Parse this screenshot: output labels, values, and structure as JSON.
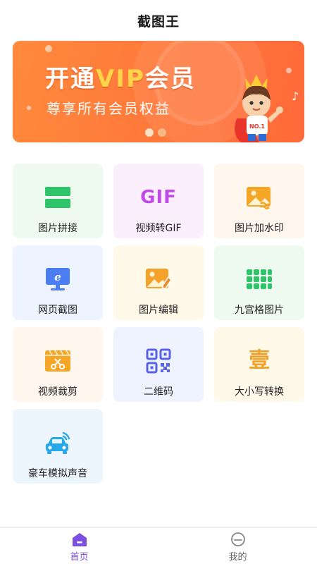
{
  "header": {
    "title": "截图王"
  },
  "banner": {
    "headline_pre": "开通",
    "headline_vip": "VIP",
    "headline_post": "会员",
    "subtitle": "尊享所有会员权益",
    "mascot_shirt": "NO.1"
  },
  "tools": [
    {
      "label": "图片拼接",
      "icon": "stack-icon",
      "bg": "#eefaf0"
    },
    {
      "label": "视频转GIF",
      "icon": "gif-icon",
      "bg": "#fbeffd"
    },
    {
      "label": "图片加水印",
      "icon": "watermark-icon",
      "bg": "#fff7ee"
    },
    {
      "label": "网页截图",
      "icon": "monitor-icon",
      "bg": "#eef4ff"
    },
    {
      "label": "图片编辑",
      "icon": "image-edit-icon",
      "bg": "#fff9e9"
    },
    {
      "label": "九宫格图片",
      "icon": "grid-icon",
      "bg": "#eefaf0"
    },
    {
      "label": "视频裁剪",
      "icon": "scissors-icon",
      "bg": "#fff7ee"
    },
    {
      "label": "二维码",
      "icon": "qrcode-icon",
      "bg": "#eef3ff"
    },
    {
      "label": "大小写转换",
      "icon": "uppercase-icon",
      "bg": "#fff9e9"
    },
    {
      "label": "豪车模拟声音",
      "icon": "car-icon",
      "bg": "#eef6fd"
    }
  ],
  "tool_glyphs": {
    "gif": "GIF",
    "uppercase": "壹"
  },
  "tabbar": {
    "home": {
      "label": "首页",
      "active": true,
      "color": "#7b4ee0"
    },
    "mine": {
      "label": "我的",
      "active": false,
      "color": "#666666"
    }
  }
}
